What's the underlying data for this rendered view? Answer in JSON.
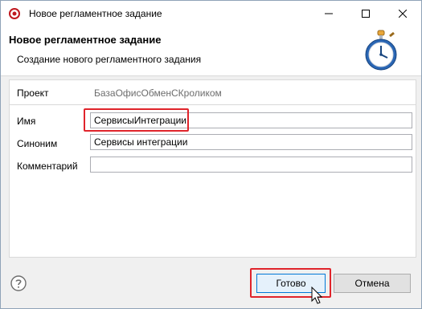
{
  "window": {
    "title": "Новое регламентное задание"
  },
  "header": {
    "title": "Новое регламентное задание",
    "subtitle": "Создание нового регламентного задания"
  },
  "form": {
    "project_label": "Проект",
    "project_value": "БазаОфисОбменСКроликом",
    "name_label": "Имя",
    "name_value": "СервисыИнтеграции",
    "synonym_label": "Синоним",
    "synonym_value": "Сервисы интеграции",
    "comment_label": "Комментарий",
    "comment_value": ""
  },
  "buttons": {
    "finish": "Готово",
    "cancel": "Отмена"
  },
  "colors": {
    "highlight": "#e0242b",
    "accent": "#0078d7"
  },
  "icons": [
    "app-icon",
    "minimize-icon",
    "maximize-icon",
    "close-icon",
    "stopwatch-icon",
    "help-icon",
    "mouse-cursor-icon"
  ]
}
